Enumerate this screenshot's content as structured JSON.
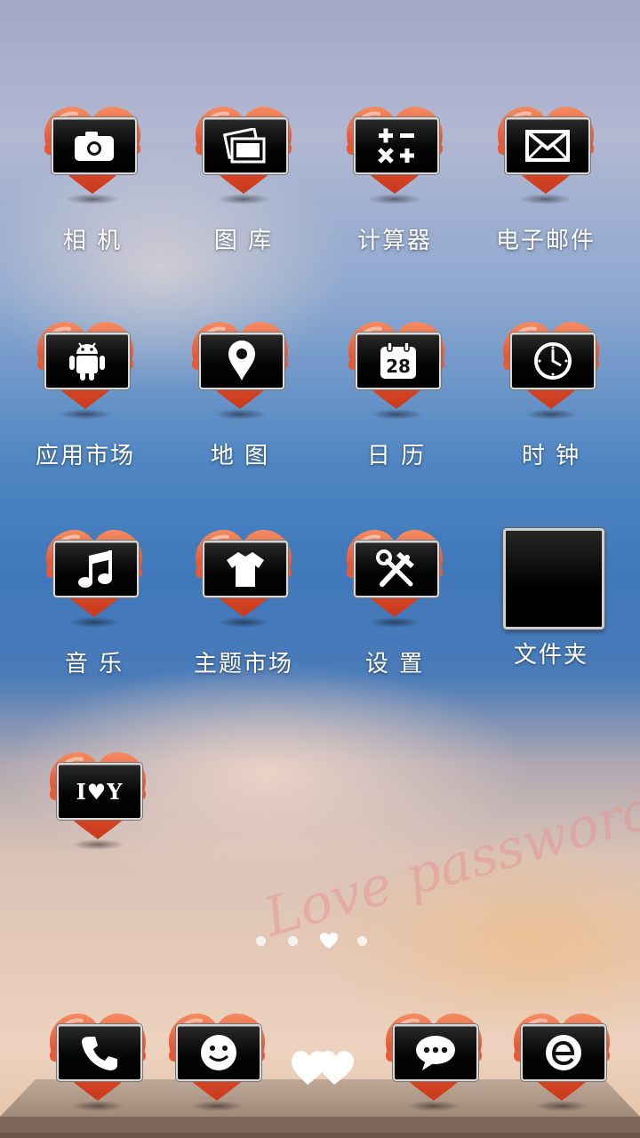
{
  "apps": [
    {
      "label": "相 机",
      "icon": "camera-icon"
    },
    {
      "label": "图 库",
      "icon": "gallery-icon"
    },
    {
      "label": "计算器",
      "icon": "calculator-icon"
    },
    {
      "label": "电子邮件",
      "icon": "email-icon"
    },
    {
      "label": "应用市场",
      "icon": "android-icon"
    },
    {
      "label": "地 图",
      "icon": "map-pin-icon"
    },
    {
      "label": "日 历",
      "icon": "calendar-icon",
      "day": "28"
    },
    {
      "label": "时 钟",
      "icon": "clock-icon"
    },
    {
      "label": "音 乐",
      "icon": "music-note-icon"
    },
    {
      "label": "主题市场",
      "icon": "tshirt-icon"
    },
    {
      "label": "设 置",
      "icon": "tools-icon"
    },
    {
      "label": "I♥Y",
      "icon": "i-love-you-icon",
      "icon_text": "I♥Y"
    }
  ],
  "folder": {
    "label": "文件夹"
  },
  "page_indicator": {
    "count": 4,
    "current": 3
  },
  "watermark": "Love password",
  "dock": [
    {
      "icon": "phone-icon"
    },
    {
      "icon": "smiley-icon"
    },
    {
      "icon": "double-heart-icon"
    },
    {
      "icon": "chat-bubble-icon"
    },
    {
      "icon": "browser-e-icon"
    }
  ],
  "colors": {
    "heart_red": "#e3502e",
    "heart_highlight": "#f7a07d",
    "label_text": "#ffffff"
  }
}
